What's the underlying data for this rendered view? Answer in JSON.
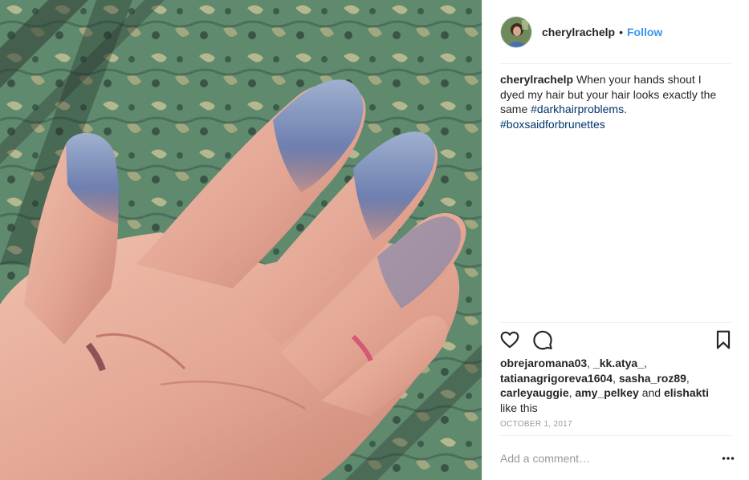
{
  "post": {
    "image": {
      "description_icon": "hand-with-dyed-fingertips-photo",
      "colors": {
        "background_carpet": "#5f8a6e",
        "skin": "#e3a897",
        "dye": "#5c6fa3"
      }
    },
    "header": {
      "username": "cherylrachelp",
      "separator": "•",
      "follow_label": "Follow",
      "avatar_icon": "avatar-photo"
    },
    "caption": {
      "username": "cherylrachelp",
      "text": " When your hands shout I dyed my hair but your hair looks exactly the same ",
      "hashtag1": "#darkhairproblems",
      "text2": ". ",
      "hashtag2": "#boxsaidforbrunettes"
    },
    "actions": {
      "like_icon": "heart-icon",
      "comment_icon": "comment-icon",
      "save_icon": "bookmark-icon"
    },
    "likes": {
      "users": [
        "obrejaromana03",
        "_kk.atya_",
        "tatianagrigoreva1604",
        "sasha_roz89",
        "carleyauggie",
        "amy_pelkey"
      ],
      "and_word": "and",
      "last_user": "elishakti",
      "suffix": "like this"
    },
    "date": "OCTOBER 1, 2017",
    "comment": {
      "placeholder": "Add a comment…",
      "more_icon": "more-options-icon"
    },
    "colors": {
      "accent": "#3897f0",
      "hashtag": "#003569",
      "muted": "#999999",
      "text": "#262626"
    }
  }
}
